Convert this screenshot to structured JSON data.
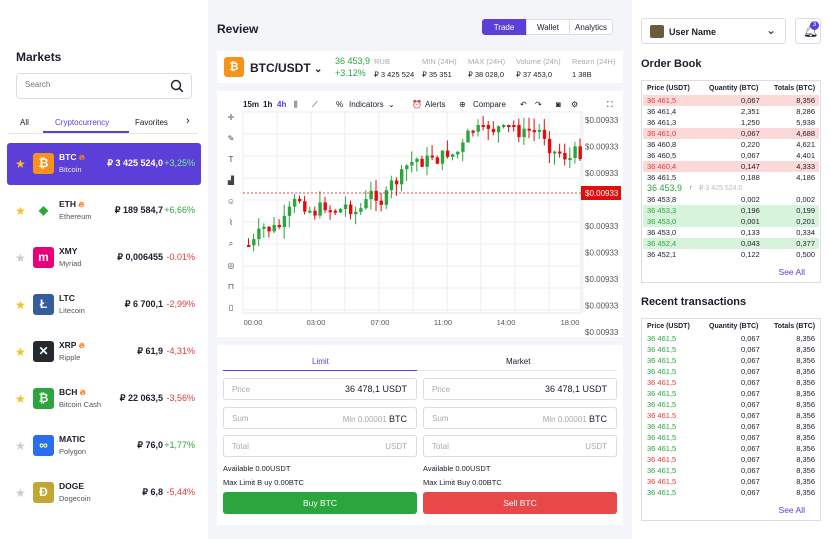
{
  "markets": {
    "title": "Markets",
    "search_placeholder": "Search",
    "tabs": [
      "All",
      "Cryptocurrency",
      "Favorites"
    ],
    "items": [
      {
        "symbol": "BTC",
        "name": "Bitcoin",
        "price": "₽ 3 425 524,0",
        "change": "+3,25%",
        "fav": true,
        "hot": true,
        "icon": "bitcoin-icon",
        "color": "#f7931a"
      },
      {
        "symbol": "ETH",
        "name": "Ethereum",
        "price": "₽ 189 584,7",
        "change": "+6,66%",
        "fav": true,
        "hot": true,
        "icon": "ethereum-icon",
        "color": "#ffffff"
      },
      {
        "symbol": "XMY",
        "name": "Myriad",
        "price": "₽ 0,006455",
        "change": "-0.01%",
        "fav": false,
        "hot": false,
        "icon": "myriad-icon",
        "color": "#e6007a"
      },
      {
        "symbol": "LTC",
        "name": "Litecoin",
        "price": "₽ 6 700,1",
        "change": "-2,99%",
        "fav": true,
        "hot": false,
        "icon": "litecoin-icon",
        "color": "#345d9d"
      },
      {
        "symbol": "XRP",
        "name": "Ripple",
        "price": "₽ 61,9",
        "change": "-4,31%",
        "fav": true,
        "hot": true,
        "icon": "ripple-icon",
        "color": "#23292f"
      },
      {
        "symbol": "BCH",
        "name": "Bitcoin Cash",
        "price": "₽ 22 063,5",
        "change": "-3,56%",
        "fav": true,
        "hot": true,
        "icon": "bitcoin-cash-icon",
        "color": "#2aa63d"
      },
      {
        "symbol": "MATIC",
        "name": "Polygon",
        "price": "₽ 76,0",
        "change": "+1,77%",
        "fav": false,
        "hot": false,
        "icon": "polygon-icon",
        "color": "#2b6def"
      },
      {
        "symbol": "DOGE",
        "name": "Dogecoin",
        "price": "₽ 6,8",
        "change": "-5,44%",
        "fav": false,
        "hot": false,
        "icon": "dogecoin-icon",
        "color": "#c2a633"
      }
    ]
  },
  "review": {
    "title": "Review",
    "views": [
      "Trade",
      "Wallet",
      "Analytics"
    ],
    "pair": "BTC/USDT",
    "last_price": "36 453,9",
    "last_change": "+3.12%",
    "rub_label": "RUB",
    "rub_value": "₽ 3 425 524",
    "stats": [
      {
        "label": "MIN (24H)",
        "value": "₽ 35 351"
      },
      {
        "label": "MAX (24H)",
        "value": "₽ 38 028,0"
      },
      {
        "label": "Volume (24h)",
        "value": "₽ 37 453,0"
      },
      {
        "label": "Return (24H)",
        "value": "1 38B"
      }
    ]
  },
  "chart_toolbar": {
    "intervals": [
      "15m",
      "1h",
      "4h"
    ],
    "indicators": "Indicators",
    "alerts": "Alerts",
    "compare": "Compare"
  },
  "chart_data": {
    "type": "candlestick",
    "x_ticks": [
      "00:00",
      "03:00",
      "07:00",
      "11:00",
      "14:00",
      "18:00"
    ],
    "y_ticks": [
      "$0.00933",
      "$0.00933",
      "$0.00933",
      "$0.00933",
      "$0.00933",
      "$0.00933",
      "$0.00933",
      "$0.00933",
      "$0.00933"
    ],
    "current_price_label": "$0.00933",
    "colors": {
      "up": "#2aa63d",
      "down": "#e00d0d"
    }
  },
  "trade": {
    "tabs": [
      "Limit",
      "Market"
    ],
    "buy": {
      "price_label": "Price",
      "price_value": "36 478,1 USDT",
      "sum_label": "Sum",
      "sum_hint": "Min 0.00001",
      "sum_unit": "BTC",
      "total_label": "Total",
      "total_unit": "USDT",
      "available": "Available 0.00USDT",
      "max": "Max Limit B uy 0.00BTC",
      "button": "Buy BTC"
    },
    "sell": {
      "price_label": "Price",
      "price_value": "36 478,1 USDT",
      "sum_label": "Sum",
      "sum_hint": "Min 0.00001",
      "sum_unit": "BTC",
      "total_label": "Total",
      "total_unit": "USDT",
      "available": "Available 0.00USDT",
      "max": "Max Limit Buy 0.00BTC",
      "button": "Sell BTC"
    }
  },
  "user": {
    "name": "User Name",
    "notifications": "3"
  },
  "order_book": {
    "title": "Order Book",
    "headers": [
      "Price (USDT)",
      "Quantity (BTC)",
      "Totals (BTC)"
    ],
    "asks": [
      {
        "price": "36 461,5",
        "qty": "0,067",
        "total": "8,356",
        "hl": true
      },
      {
        "price": "36 461,4",
        "qty": "2,351",
        "total": "8,286",
        "hl": false
      },
      {
        "price": "36 461,3",
        "qty": "1,250",
        "total": "5,938",
        "hl": false
      },
      {
        "price": "36 461,0",
        "qty": "0,067",
        "total": "4,688",
        "hl": true
      },
      {
        "price": "36 460,8",
        "qty": "0,220",
        "total": "4,621",
        "hl": false
      },
      {
        "price": "36 460,5",
        "qty": "0,067",
        "total": "4,401",
        "hl": false
      },
      {
        "price": "36 460,4",
        "qty": "0,147",
        "total": "4,333",
        "hl": true
      },
      {
        "price": "36 461,5",
        "qty": "0,188",
        "total": "4,186",
        "hl": false
      }
    ],
    "mid_price": "36 453,9",
    "mid_rub": "₽ 3 425 524,0",
    "bids": [
      {
        "price": "36 453,8",
        "qty": "0,002",
        "total": "0,002",
        "hl": false
      },
      {
        "price": "36 453,3",
        "qty": "0,196",
        "total": "0,199",
        "hl": true
      },
      {
        "price": "36 453,0",
        "qty": "0,001",
        "total": "0,201",
        "hl": true
      },
      {
        "price": "36 453,0",
        "qty": "0,133",
        "total": "0,334",
        "hl": false
      },
      {
        "price": "36 452,4",
        "qty": "0,043",
        "total": "0,377",
        "hl": true
      },
      {
        "price": "36 452,1",
        "qty": "0,122",
        "total": "0,500",
        "hl": false
      }
    ],
    "see_all": "See All"
  },
  "recent": {
    "title": "Recent transactions",
    "headers": [
      "Price (USDT)",
      "Quantity (BTC)",
      "Totals (BTC)"
    ],
    "rows": [
      {
        "price": "36 461,5",
        "qty": "0,067",
        "total": "8,356",
        "side": "up"
      },
      {
        "price": "36 461,5",
        "qty": "0,067",
        "total": "8,356",
        "side": "up"
      },
      {
        "price": "36 461,5",
        "qty": "0,067",
        "total": "8,356",
        "side": "up"
      },
      {
        "price": "36 461,5",
        "qty": "0,067",
        "total": "8,356",
        "side": "up"
      },
      {
        "price": "36 461,5",
        "qty": "0,067",
        "total": "8,356",
        "side": "dn"
      },
      {
        "price": "36 461,5",
        "qty": "0,067",
        "total": "8,356",
        "side": "up"
      },
      {
        "price": "36 461,5",
        "qty": "0,067",
        "total": "8,356",
        "side": "up"
      },
      {
        "price": "36 461,5",
        "qty": "0,067",
        "total": "8,356",
        "side": "dn"
      },
      {
        "price": "36 461,5",
        "qty": "0,067",
        "total": "8,356",
        "side": "up"
      },
      {
        "price": "36 461,5",
        "qty": "0,067",
        "total": "8,356",
        "side": "up"
      },
      {
        "price": "36 461,5",
        "qty": "0,067",
        "total": "8,356",
        "side": "up"
      },
      {
        "price": "36 461,5",
        "qty": "0,067",
        "total": "8,356",
        "side": "dn"
      },
      {
        "price": "36 461,5",
        "qty": "0,067",
        "total": "8,356",
        "side": "up"
      },
      {
        "price": "36 461,5",
        "qty": "0,067",
        "total": "8,356",
        "side": "dn"
      },
      {
        "price": "36 461,5",
        "qty": "0,067",
        "total": "8,356",
        "side": "up"
      }
    ],
    "see_all": "See All"
  }
}
